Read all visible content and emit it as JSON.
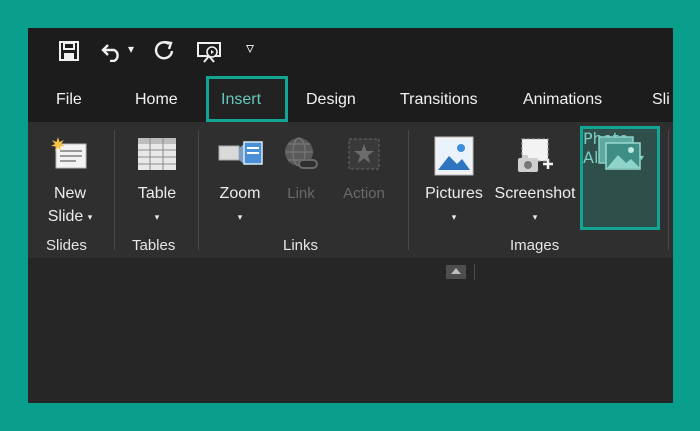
{
  "quick_access": {
    "icons": [
      "save-icon",
      "undo-icon",
      "dropdown-caret-icon",
      "redo-icon",
      "start-from-beginning-icon",
      "customize-toolbar-icon"
    ],
    "undo_caret": "▾",
    "customize_caret": "▿"
  },
  "tabs": [
    {
      "label": "File"
    },
    {
      "label": "Home"
    },
    {
      "label": "Insert",
      "active": true
    },
    {
      "label": "Design"
    },
    {
      "label": "Transitions"
    },
    {
      "label": "Animations"
    },
    {
      "label": "Sli"
    }
  ],
  "ribbon": {
    "new_slide": {
      "line1": "New",
      "line2": "Slide",
      "caret": "▾",
      "icon": "new-slide-icon"
    },
    "table": {
      "label": "Table",
      "caret": "▾",
      "icon": "table-icon"
    },
    "zoom": {
      "label": "Zoom",
      "caret": "▾",
      "icon": "zoom-icon"
    },
    "link": {
      "label": "Link",
      "icon": "link-icon"
    },
    "action": {
      "label": "Action",
      "icon": "action-icon"
    },
    "pictures": {
      "label": "Pictures",
      "caret": "▾",
      "icon": "pictures-icon"
    },
    "screenshot": {
      "label": "Screenshot",
      "caret": "▾",
      "icon": "screenshot-icon"
    },
    "photo_album": {
      "line1": "Photo",
      "line2": "Album",
      "caret": "▾",
      "icon": "photo-album-icon"
    }
  },
  "groups": {
    "slides": "Slides",
    "tables": "Tables",
    "links": "Links",
    "images": "Images"
  },
  "colors": {
    "accent": "#12a593",
    "background": "#0a9e8c",
    "window": "#262626"
  }
}
